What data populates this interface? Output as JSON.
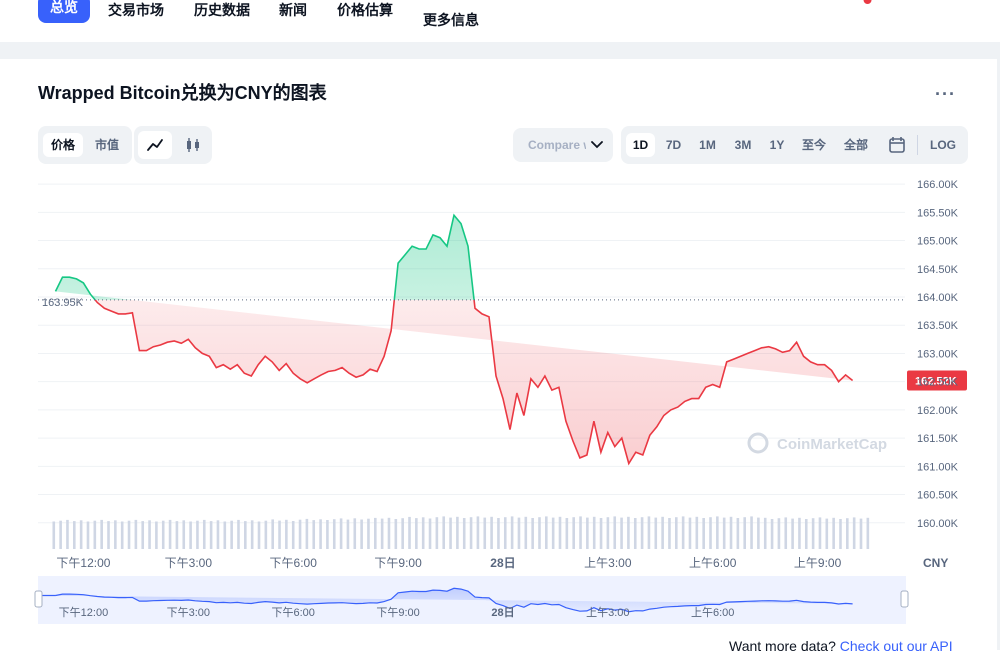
{
  "nav": {
    "tabs": [
      {
        "label": "总览",
        "active": true
      },
      {
        "label": "交易市场"
      },
      {
        "label": "历史数据"
      },
      {
        "label": "新闻"
      },
      {
        "label": "价格估算"
      },
      {
        "label": "更多信息"
      }
    ]
  },
  "header": {
    "title": "Wrapped Bitcoin兑换为CNY的图表",
    "more_icon": "more-horizontal-icon"
  },
  "toolbar": {
    "metric": [
      "价格",
      "市值"
    ],
    "metric_selected": "价格",
    "chart_styles": [
      "line-chart-icon",
      "candlestick-icon"
    ],
    "chart_style_selected": "line-chart-icon",
    "compare_label": "Compare with",
    "ranges": [
      "1D",
      "7D",
      "1M",
      "3M",
      "1Y",
      "至今",
      "全部"
    ],
    "range_selected": "1D",
    "calendar_icon": "calendar-icon",
    "log_label": "LOG"
  },
  "footer": {
    "prompt": "Want more data?",
    "link": "Check out our API"
  },
  "chart_data": {
    "type": "line",
    "title": "",
    "currency_label": "CNY",
    "watermark": "CoinMarketCap",
    "y_unit": "K",
    "ylim": [
      159.5,
      166.25
    ],
    "yticks": [
      "160.00K",
      "160.50K",
      "161.00K",
      "161.50K",
      "162.00K",
      "162.50K",
      "163.00K",
      "163.50K",
      "164.00K",
      "164.50K",
      "165.00K",
      "165.50K",
      "166.00K"
    ],
    "ytick_values": [
      160.0,
      160.5,
      161.0,
      161.5,
      162.0,
      162.5,
      163.0,
      163.5,
      164.0,
      164.5,
      165.0,
      165.5,
      166.0
    ],
    "x_domain": [
      10.7,
      35.5
    ],
    "xticks": [
      {
        "label": "下午12:00",
        "x": 12
      },
      {
        "label": "下午3:00",
        "x": 15
      },
      {
        "label": "下午6:00",
        "x": 18
      },
      {
        "label": "下午9:00",
        "x": 21
      },
      {
        "label": "28日",
        "x": 24,
        "bold": true
      },
      {
        "label": "上午3:00",
        "x": 27
      },
      {
        "label": "上午6:00",
        "x": 30
      },
      {
        "label": "上午9:00",
        "x": 33
      }
    ],
    "navigator_xticks": [
      {
        "label": "下午12:00",
        "x": 12
      },
      {
        "label": "下午3:00",
        "x": 15
      },
      {
        "label": "下午6:00",
        "x": 18
      },
      {
        "label": "下午9:00",
        "x": 21
      },
      {
        "label": "28日",
        "x": 24,
        "bold": true
      },
      {
        "label": "上午3:00",
        "x": 27
      },
      {
        "label": "上午6:00",
        "x": 30
      }
    ],
    "baseline": {
      "value": 163.95,
      "label": "163.95K"
    },
    "last": {
      "value": 162.52,
      "label": "162.52K"
    },
    "colors": {
      "up": "#16c784",
      "down": "#ea3943",
      "grid": "#eff2f5",
      "navigator": "#3861fb"
    },
    "x": [
      11.2,
      11.4,
      11.6,
      11.8,
      12.0,
      12.2,
      12.4,
      12.6,
      12.8,
      13.0,
      13.2,
      13.4,
      13.6,
      13.8,
      14.0,
      14.2,
      14.4,
      14.6,
      14.8,
      15.0,
      15.2,
      15.4,
      15.6,
      15.8,
      16.0,
      16.2,
      16.4,
      16.6,
      16.8,
      17.0,
      17.2,
      17.4,
      17.6,
      17.8,
      18.0,
      18.2,
      18.4,
      18.6,
      18.8,
      19.0,
      19.2,
      19.4,
      19.6,
      19.8,
      20.0,
      20.2,
      20.4,
      20.6,
      20.8,
      21.0,
      21.2,
      21.4,
      21.6,
      21.8,
      22.0,
      22.2,
      22.4,
      22.6,
      22.8,
      23.0,
      23.2,
      23.4,
      23.6,
      23.8,
      24.0,
      24.2,
      24.4,
      24.6,
      24.8,
      25.0,
      25.2,
      25.4,
      25.6,
      25.8,
      26.0,
      26.2,
      26.4,
      26.6,
      26.8,
      27.0,
      27.2,
      27.4,
      27.6,
      27.8,
      28.0,
      28.2,
      28.4,
      28.6,
      28.8,
      29.0,
      29.2,
      29.4,
      29.6,
      29.8,
      30.0,
      30.2,
      30.4,
      30.6,
      30.8,
      31.0,
      31.2,
      31.4,
      31.6,
      31.8,
      32.0,
      32.2,
      32.4,
      32.6,
      32.8,
      33.0,
      33.2,
      33.4,
      33.6,
      33.8,
      34.0,
      34.2,
      34.4
    ],
    "values": [
      164.1,
      164.35,
      164.35,
      164.32,
      164.25,
      164.05,
      163.9,
      163.8,
      163.75,
      163.7,
      163.7,
      163.72,
      163.05,
      163.05,
      163.12,
      163.15,
      163.2,
      163.22,
      163.18,
      163.25,
      163.1,
      163.0,
      162.95,
      162.75,
      162.8,
      162.72,
      162.8,
      162.65,
      162.6,
      162.8,
      162.95,
      162.85,
      162.7,
      162.82,
      162.65,
      162.55,
      162.48,
      162.55,
      162.62,
      162.68,
      162.7,
      162.75,
      162.65,
      162.58,
      162.62,
      162.72,
      162.68,
      162.95,
      163.4,
      164.6,
      164.75,
      164.9,
      164.85,
      164.85,
      165.1,
      165.05,
      164.9,
      165.45,
      165.3,
      164.9,
      163.8,
      163.7,
      163.65,
      162.6,
      162.2,
      161.65,
      162.3,
      161.9,
      162.55,
      162.4,
      162.6,
      162.35,
      162.4,
      161.8,
      161.45,
      161.15,
      161.2,
      161.8,
      161.25,
      161.6,
      161.35,
      161.5,
      161.05,
      161.25,
      161.2,
      161.55,
      161.7,
      161.9,
      162.0,
      162.05,
      162.15,
      162.2,
      162.2,
      162.4,
      162.45,
      162.4,
      162.85,
      162.9,
      162.95,
      163.0,
      163.05,
      163.1,
      163.12,
      163.08,
      163.02,
      163.05,
      163.2,
      162.95,
      162.85,
      162.8,
      162.8,
      162.7,
      162.5,
      162.62,
      162.52
    ],
    "volume_x": [
      11.2,
      34.4
    ],
    "volume_values": [
      0.55,
      0.55,
      0.55,
      0.55,
      0.55,
      0.55,
      0.55,
      0.55,
      0.56,
      0.57,
      0.58,
      0.59,
      0.6,
      0.61,
      0.62,
      0.62,
      0.62,
      0.62,
      0.62,
      0.62,
      0.62,
      0.62,
      0.62,
      0.62,
      0.62,
      0.62,
      0.6,
      0.6,
      0.6,
      0.6
    ]
  }
}
